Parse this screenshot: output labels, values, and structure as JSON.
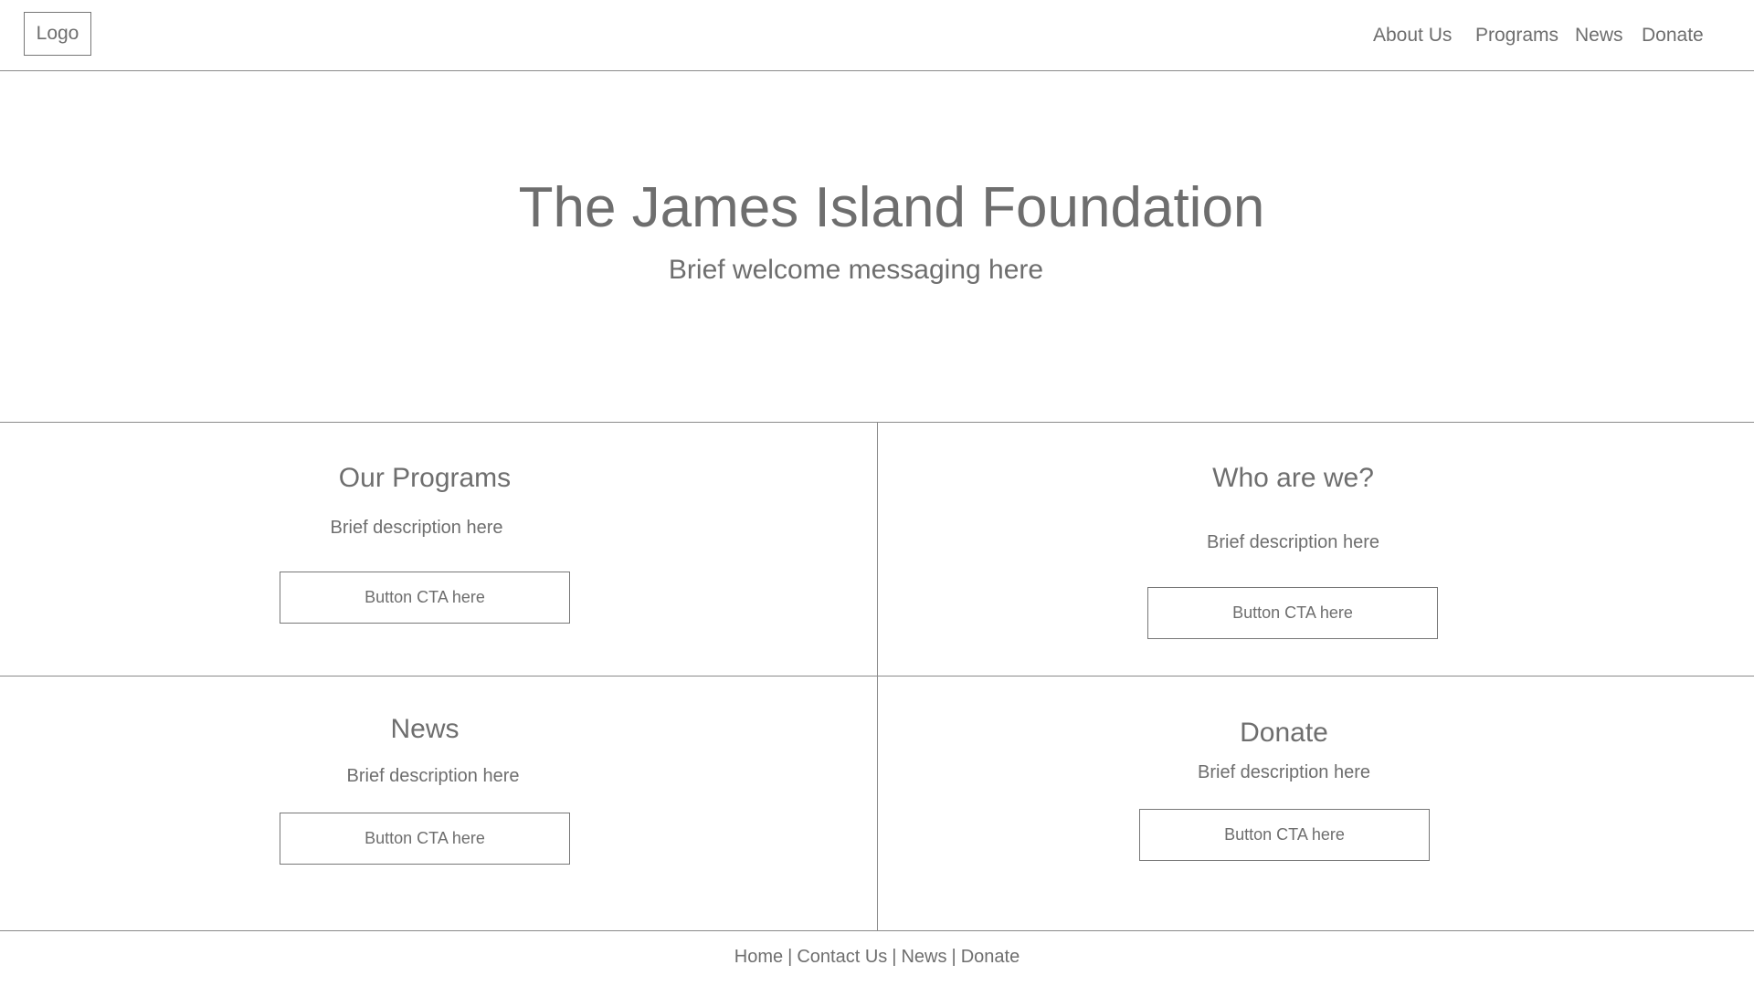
{
  "header": {
    "logo_label": "Logo",
    "nav": [
      {
        "label": "About Us"
      },
      {
        "label": "Programs"
      },
      {
        "label": "News"
      },
      {
        "label": "Donate"
      }
    ]
  },
  "hero": {
    "title": "The James Island Foundation",
    "subtitle": "Brief welcome messaging here"
  },
  "cards": [
    {
      "title": "Our Programs",
      "description": "Brief description here",
      "cta": "Button CTA here"
    },
    {
      "title": "Who are we?",
      "description": "Brief description here",
      "cta": "Button CTA here"
    },
    {
      "title": "News",
      "description": "Brief description here",
      "cta": "Button CTA here"
    },
    {
      "title": "Donate",
      "description": "Brief description here",
      "cta": "Button CTA here"
    }
  ],
  "footer": {
    "links": [
      {
        "label": "Home"
      },
      {
        "label": "Contact Us"
      },
      {
        "label": "News"
      },
      {
        "label": "Donate"
      }
    ],
    "separator": "|"
  },
  "colors": {
    "text": "#6e6e6e",
    "border": "#777777",
    "divider": "#8a8a8a",
    "background": "#ffffff"
  }
}
